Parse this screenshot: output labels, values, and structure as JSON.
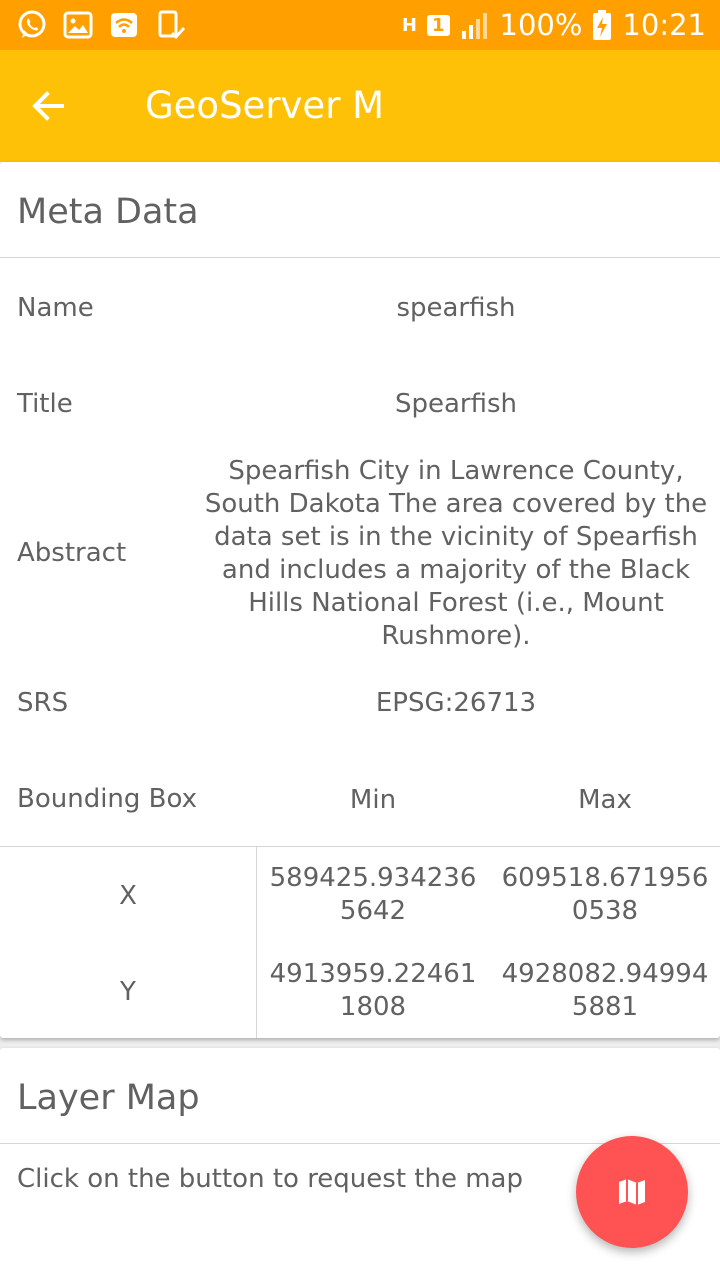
{
  "status_bar": {
    "battery": "100%",
    "time": "10:21",
    "sim_slot": "1",
    "network_type": "H",
    "left_icons": [
      "whatsapp-icon",
      "gallery-icon",
      "wifi-hotspot-icon",
      "device-check-icon"
    ],
    "background": "#FFA000"
  },
  "app_bar": {
    "title": "GeoServer M",
    "background": "#FFC107"
  },
  "metadata": {
    "header": "Meta Data",
    "name_label": "Name",
    "name_value": "spearfish",
    "title_label": "Title",
    "title_value": "Spearfish",
    "abstract_label": "Abstract",
    "abstract_lines": [
      "Spearfish City in Lawrence County,",
      "South Dakota  The area covered by the",
      "data set is in the vicinity of Spearfish",
      "and includes a majority of the Black",
      "Hills National Forest (i.e., Mount",
      "Rushmore)."
    ],
    "srs_label": "SRS",
    "srs_value": "EPSG:26713",
    "bbox": {
      "label": "Bounding Box",
      "min_label": "Min",
      "max_label": "Max",
      "x_label": "X",
      "x_min": [
        "589425.934236",
        "5642"
      ],
      "x_max": [
        "609518.671956",
        "0538"
      ],
      "y_label": "Y",
      "y_min": [
        "4913959.22461",
        "1808"
      ],
      "y_max": [
        "4928082.94994",
        "5881"
      ]
    }
  },
  "layer_map": {
    "header": "Layer Map",
    "hint": "Click on the button to request the map",
    "fab_icon": "map-icon",
    "fab_color": "#FF5252"
  }
}
